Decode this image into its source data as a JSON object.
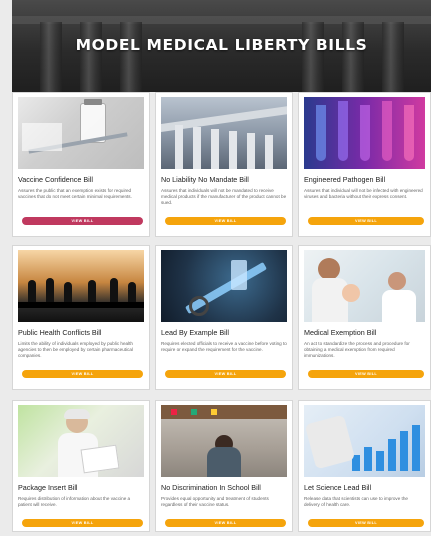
{
  "hero": {
    "title": "MODEL MEDICAL LIBERTY BILLS"
  },
  "colors": {
    "button": "#f5a40c",
    "button_active": "#c0395f",
    "hero": "#2b2b2b"
  },
  "bills": [
    {
      "title": "Vaccine Confidence Bill",
      "description": "Assures the public that an exemption exists for required vaccines that do not meet certain minimal requirements.",
      "button": "VIEW BILL",
      "image": "vaccine-vial-image"
    },
    {
      "title": "No Liability No Mandate Bill",
      "description": "Assures that individuals will not be mandated to receive medical products if the manufacturer of the product cannot be sued.",
      "button": "VIEW BILL",
      "image": "courthouse-image"
    },
    {
      "title": "Engineered Pathogen Bill",
      "description": "Assures that individual will not be infected with engineered viruses and bacteria without their express consent.",
      "button": "VIEW BILL",
      "image": "test-tubes-image"
    },
    {
      "title": "Public Health Conflicts Bill",
      "description": "Limits the ability of individuals employed by public health agencies to then be employed by certain pharmaceutical companies.",
      "button": "VIEW BILL",
      "image": "boardroom-image"
    },
    {
      "title": "Lead By Example Bill",
      "description": "Requires elected officials to receive a vaccine before voting to require or expand the requirement for the vaccine.",
      "button": "VIEW BILL",
      "image": "syringe-image"
    },
    {
      "title": "Medical Exemption Bill",
      "description": "An act to standardize the process and procedure for obtaining a medical exemption from required immunizations.",
      "button": "VIEW BILL",
      "image": "mother-baby-image"
    },
    {
      "title": "Package Insert Bill",
      "description": "Requires distribution of information about the vaccine a patient will receive.",
      "button": "VIEW BILL",
      "image": "reading-document-image"
    },
    {
      "title": "No Discrimination In School Bill",
      "description": "Provides equal opportunity and treatment of students regardless of their vaccine status.",
      "button": "VIEW BILL",
      "image": "student-image"
    },
    {
      "title": "Let Science Lead Bill",
      "description": "Release data that scientists can use to improve the delivery of health care.",
      "button": "VIEW BILL",
      "image": "data-chart-image"
    }
  ]
}
